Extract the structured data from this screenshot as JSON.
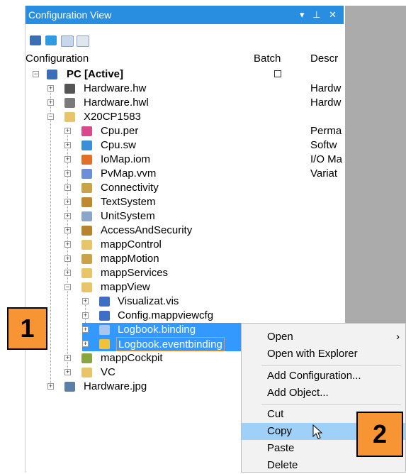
{
  "panel": {
    "title": "Configuration View",
    "title_controls": "▾ ⁠ꟷ ✕"
  },
  "columns": {
    "configuration": "Configuration",
    "batch": "Batch",
    "description": "Descr"
  },
  "tree": {
    "root": "PC [Active]",
    "hardware_hw": "Hardware.hw",
    "hardware_hwl": "Hardware.hwl",
    "cpu": "X20CP1583",
    "cpu_per": "Cpu.per",
    "cpu_sw": "Cpu.sw",
    "iomap": "IoMap.iom",
    "pvmap": "PvMap.vvm",
    "connectivity": "Connectivity",
    "textsystem": "TextSystem",
    "unitsystem": "UnitSystem",
    "access": "AccessAndSecurity",
    "mappcontrol": "mappControl",
    "mappmotion": "mappMotion",
    "mappservices": "mappServices",
    "mappview": "mappView",
    "visualizat": "Visualizat.vis",
    "configmv": "Config.mappviewcfg",
    "logbook_binding": "Logbook.binding",
    "logbook_eventbinding": "Logbook.eventbinding",
    "mappcockpit": "mappCockpit",
    "vc": "VC",
    "hardware_jpg": "Hardware.jpg"
  },
  "descriptions": {
    "hardware_hw": "Hardw",
    "hardware_hwl": "Hardw",
    "cpu_per": "Perma",
    "cpu_sw": "Softw",
    "iomap": "I/O Ma",
    "pvmap": "Variat"
  },
  "context_menu": {
    "open": "Open",
    "open_explorer": "Open with Explorer",
    "add_config": "Add Configuration...",
    "add_object": "Add Object...",
    "cut": "Cut",
    "copy": "Copy",
    "paste": "Paste",
    "delete": "Delete",
    "submenu_arrow": "›"
  },
  "badges": {
    "step1": "1",
    "step2": "2"
  },
  "colors": {
    "accent": "#2a8ee0",
    "selection": "#3399ff",
    "badge": "#f79433"
  }
}
